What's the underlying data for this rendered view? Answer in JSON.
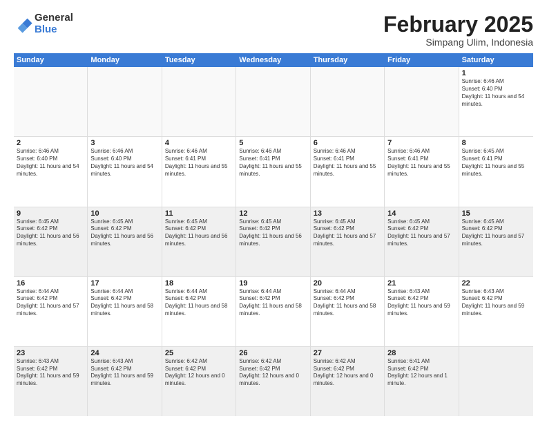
{
  "header": {
    "logo_general": "General",
    "logo_blue": "Blue",
    "title": "February 2025",
    "subtitle": "Simpang Ulim, Indonesia"
  },
  "days_of_week": [
    "Sunday",
    "Monday",
    "Tuesday",
    "Wednesday",
    "Thursday",
    "Friday",
    "Saturday"
  ],
  "weeks": [
    [
      {
        "day": "",
        "info": "",
        "empty": true
      },
      {
        "day": "",
        "info": "",
        "empty": true
      },
      {
        "day": "",
        "info": "",
        "empty": true
      },
      {
        "day": "",
        "info": "",
        "empty": true
      },
      {
        "day": "",
        "info": "",
        "empty": true
      },
      {
        "day": "",
        "info": "",
        "empty": true
      },
      {
        "day": "1",
        "info": "Sunrise: 6:46 AM\nSunset: 6:40 PM\nDaylight: 11 hours and 54 minutes."
      }
    ],
    [
      {
        "day": "2",
        "info": "Sunrise: 6:46 AM\nSunset: 6:40 PM\nDaylight: 11 hours and 54 minutes."
      },
      {
        "day": "3",
        "info": "Sunrise: 6:46 AM\nSunset: 6:40 PM\nDaylight: 11 hours and 54 minutes."
      },
      {
        "day": "4",
        "info": "Sunrise: 6:46 AM\nSunset: 6:41 PM\nDaylight: 11 hours and 55 minutes."
      },
      {
        "day": "5",
        "info": "Sunrise: 6:46 AM\nSunset: 6:41 PM\nDaylight: 11 hours and 55 minutes."
      },
      {
        "day": "6",
        "info": "Sunrise: 6:46 AM\nSunset: 6:41 PM\nDaylight: 11 hours and 55 minutes."
      },
      {
        "day": "7",
        "info": "Sunrise: 6:46 AM\nSunset: 6:41 PM\nDaylight: 11 hours and 55 minutes."
      },
      {
        "day": "8",
        "info": "Sunrise: 6:45 AM\nSunset: 6:41 PM\nDaylight: 11 hours and 55 minutes."
      }
    ],
    [
      {
        "day": "9",
        "info": "Sunrise: 6:45 AM\nSunset: 6:42 PM\nDaylight: 11 hours and 56 minutes.",
        "shaded": true
      },
      {
        "day": "10",
        "info": "Sunrise: 6:45 AM\nSunset: 6:42 PM\nDaylight: 11 hours and 56 minutes.",
        "shaded": true
      },
      {
        "day": "11",
        "info": "Sunrise: 6:45 AM\nSunset: 6:42 PM\nDaylight: 11 hours and 56 minutes.",
        "shaded": true
      },
      {
        "day": "12",
        "info": "Sunrise: 6:45 AM\nSunset: 6:42 PM\nDaylight: 11 hours and 56 minutes.",
        "shaded": true
      },
      {
        "day": "13",
        "info": "Sunrise: 6:45 AM\nSunset: 6:42 PM\nDaylight: 11 hours and 57 minutes.",
        "shaded": true
      },
      {
        "day": "14",
        "info": "Sunrise: 6:45 AM\nSunset: 6:42 PM\nDaylight: 11 hours and 57 minutes.",
        "shaded": true
      },
      {
        "day": "15",
        "info": "Sunrise: 6:45 AM\nSunset: 6:42 PM\nDaylight: 11 hours and 57 minutes.",
        "shaded": true
      }
    ],
    [
      {
        "day": "16",
        "info": "Sunrise: 6:44 AM\nSunset: 6:42 PM\nDaylight: 11 hours and 57 minutes."
      },
      {
        "day": "17",
        "info": "Sunrise: 6:44 AM\nSunset: 6:42 PM\nDaylight: 11 hours and 58 minutes."
      },
      {
        "day": "18",
        "info": "Sunrise: 6:44 AM\nSunset: 6:42 PM\nDaylight: 11 hours and 58 minutes."
      },
      {
        "day": "19",
        "info": "Sunrise: 6:44 AM\nSunset: 6:42 PM\nDaylight: 11 hours and 58 minutes."
      },
      {
        "day": "20",
        "info": "Sunrise: 6:44 AM\nSunset: 6:42 PM\nDaylight: 11 hours and 58 minutes."
      },
      {
        "day": "21",
        "info": "Sunrise: 6:43 AM\nSunset: 6:42 PM\nDaylight: 11 hours and 59 minutes."
      },
      {
        "day": "22",
        "info": "Sunrise: 6:43 AM\nSunset: 6:42 PM\nDaylight: 11 hours and 59 minutes."
      }
    ],
    [
      {
        "day": "23",
        "info": "Sunrise: 6:43 AM\nSunset: 6:42 PM\nDaylight: 11 hours and 59 minutes.",
        "shaded": true
      },
      {
        "day": "24",
        "info": "Sunrise: 6:43 AM\nSunset: 6:42 PM\nDaylight: 11 hours and 59 minutes.",
        "shaded": true
      },
      {
        "day": "25",
        "info": "Sunrise: 6:42 AM\nSunset: 6:42 PM\nDaylight: 12 hours and 0 minutes.",
        "shaded": true
      },
      {
        "day": "26",
        "info": "Sunrise: 6:42 AM\nSunset: 6:42 PM\nDaylight: 12 hours and 0 minutes.",
        "shaded": true
      },
      {
        "day": "27",
        "info": "Sunrise: 6:42 AM\nSunset: 6:42 PM\nDaylight: 12 hours and 0 minutes.",
        "shaded": true
      },
      {
        "day": "28",
        "info": "Sunrise: 6:41 AM\nSunset: 6:42 PM\nDaylight: 12 hours and 1 minute.",
        "shaded": true
      },
      {
        "day": "",
        "info": "",
        "empty": true,
        "shaded": true
      }
    ]
  ]
}
